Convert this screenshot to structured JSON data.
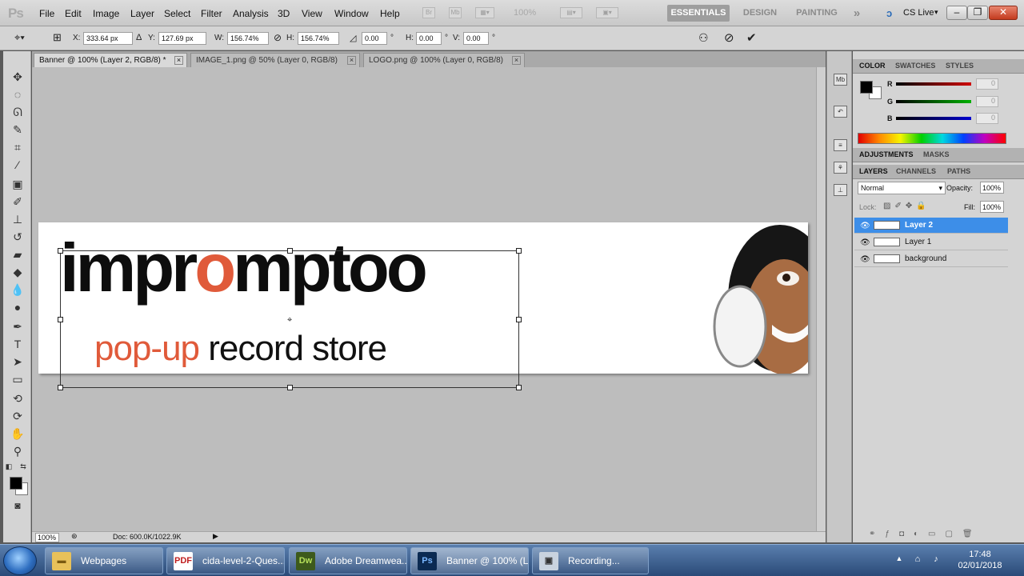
{
  "app": {
    "logo": "Ps",
    "menu": [
      "File",
      "Edit",
      "Image",
      "Layer",
      "Select",
      "Filter",
      "Analysis",
      "3D",
      "View",
      "Window",
      "Help"
    ],
    "mini_icons": [
      "Br",
      "Mb"
    ],
    "zoom_readout": "100%",
    "workspaces": [
      "ESSENTIALS",
      "DESIGN",
      "PAINTING"
    ],
    "overflow": "»",
    "cs_live": "CS Live"
  },
  "options": {
    "x_label": "X:",
    "x": "333.64 px",
    "y_label": "Y:",
    "y": "127.69 px",
    "w_label": "W:",
    "w": "156.74%",
    "h_label": "H:",
    "h": "156.74%",
    "angle": "0.00",
    "deg": "°",
    "hskew_label": "H:",
    "hskew": "0.00",
    "vskew_label": "V:",
    "vskew": "0.00"
  },
  "tabs": [
    {
      "label": "Banner @ 100% (Layer 2, RGB/8) *"
    },
    {
      "label": "IMAGE_1.png @ 50% (Layer 0, RGB/8)"
    },
    {
      "label": "LOGO.png @ 100% (Layer 0, RGB/8)"
    }
  ],
  "banner": {
    "word_a": "impr",
    "word_o": "o",
    "word_b": "mptoo",
    "tag_accent": "pop-up",
    "tag_rest": " record store"
  },
  "status": {
    "zoom": "100%",
    "doc": "Doc: 600.0K/1022.9K"
  },
  "color_panel": {
    "tabs": [
      "COLOR",
      "SWATCHES",
      "STYLES"
    ],
    "channels": [
      {
        "label": "R",
        "value": "0",
        "color": "#d00000"
      },
      {
        "label": "G",
        "value": "0",
        "color": "#00b000"
      },
      {
        "label": "B",
        "value": "0",
        "color": "#0000d0"
      }
    ]
  },
  "adjust_tabs": [
    "ADJUSTMENTS",
    "MASKS"
  ],
  "layers_panel": {
    "tabs": [
      "LAYERS",
      "CHANNELS",
      "PATHS"
    ],
    "blend_mode": "Normal",
    "opacity_label": "Opacity:",
    "opacity": "100%",
    "lock_label": "Lock:",
    "fill_label": "Fill:",
    "fill": "100%",
    "layers": [
      {
        "name": "Layer 2",
        "selected": true
      },
      {
        "name": "Layer 1",
        "selected": false
      },
      {
        "name": "background",
        "selected": false
      }
    ]
  },
  "taskbar": {
    "items": [
      {
        "label": "Webpages",
        "icon": "folder-icon"
      },
      {
        "label": "cida-level-2-Ques...",
        "icon": "pdf-icon"
      },
      {
        "label": "Adobe Dreamwea...",
        "icon": "dreamweaver-icon"
      },
      {
        "label": "Banner @ 100% (L...",
        "icon": "photoshop-icon"
      },
      {
        "label": "Recording...",
        "icon": "recorder-icon"
      }
    ],
    "time": "17:48",
    "date": "02/01/2018"
  }
}
